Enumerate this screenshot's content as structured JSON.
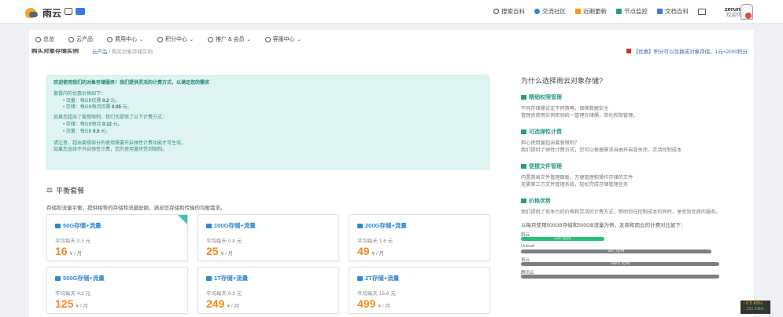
{
  "header": {
    "logo_text": "雨云",
    "nav": [
      {
        "label": "搜索百科",
        "icon": "search-icon"
      },
      {
        "label": "交流社区",
        "icon": "droplet-icon"
      },
      {
        "label": "近期更新",
        "icon": "calendar-icon"
      },
      {
        "label": "节点监控",
        "icon": "send-icon"
      },
      {
        "label": "文档百科",
        "icon": "document-icon"
      }
    ],
    "username": "zeruns",
    "user_sub": "欢迎你"
  },
  "menu": [
    {
      "label": "总览",
      "icon": "dashboard-icon"
    },
    {
      "label": "云产品",
      "icon": "cloud-icon"
    },
    {
      "label": "费用中心",
      "icon": "yen-icon"
    },
    {
      "label": "积分中心",
      "icon": "points-icon"
    },
    {
      "label": "推广 & 会员",
      "icon": "users-icon"
    },
    {
      "label": "客服中心",
      "icon": "support-icon"
    }
  ],
  "breadcrumb": {
    "title": "购买对象存储实例",
    "path": [
      "云产品",
      "购买对象存储实例"
    ],
    "right_note": "【优惠】积分可以兑换成对象存储，1元=2000积分"
  },
  "notice": {
    "title": "欢迎使用我们的对象存储服务！我们提供灵活的计费方式，以满足您的需求",
    "quota_intro": "套餐内的优惠价格如下：",
    "quota": [
      {
        "pre": "流量：每GB仅需 ",
        "val": "0.2",
        "post": " 元。"
      },
      {
        "pre": "存储：每GB每月仅需 ",
        "val": "0.05",
        "post": " 元。"
      }
    ],
    "overage_intro": "如果您超出了套餐限制，我们也提供了以下计费方式：",
    "overage": [
      {
        "pre": "存储：每GB每月 ",
        "val": "0.12",
        "post": " 元。"
      },
      {
        "pre": "流量：每GB ",
        "val": "0.5",
        "post": " 元。"
      }
    ],
    "note1": "请注意，超出套餐部分的使用需要开启弹性计费功能才可生效。",
    "note2": "如果您选择不开启弹性计费，您的使用量将受到限制。"
  },
  "plans_section": {
    "title": "平衡套餐",
    "desc": "存储和流量平衡，提供相等的存储和流量配额，满足您存储和传输的均衡需求。",
    "avg_prefix": "平均每天 ",
    "price_unit": "¥ / 月",
    "plans": [
      {
        "name": "50G存储+流量",
        "avg": "0.5 元",
        "price": "16",
        "selected": true
      },
      {
        "name": "100G存储+流量",
        "avg": "0.8 元",
        "price": "25",
        "selected": false
      },
      {
        "name": "200G存储+流量",
        "avg": "1.6 元",
        "price": "49",
        "selected": false
      },
      {
        "name": "500G存储+流量",
        "avg": "4.2 元",
        "price": "125",
        "selected": false
      },
      {
        "name": "1T存储+流量",
        "avg": "8.3 元",
        "price": "249",
        "selected": false
      },
      {
        "name": "2T存储+流量",
        "avg": "16.6 元",
        "price": "499",
        "selected": false
      }
    ]
  },
  "sidebar": {
    "heading": "为什么选择雨云对象存储?",
    "blocks": [
      {
        "title": "精细权限管理",
        "lines": [
          "不同存储桶设定不同策略，保障数据安全",
          "管理员使用实例密钥统一管理存储桶，简化权限管理。"
        ]
      },
      {
        "title": "可选弹性计费",
        "lines": [
          "担心使用量超出套餐限制？",
          "我们提供了弹性计费方式，您可以根据需求自由开启或关闭，灵活控制成本"
        ]
      },
      {
        "title": "便捷文件管理",
        "lines": [
          "内置简易文件管理面板，方便管理和操作存储的文件",
          "无需第三方文件管理系统，轻松完成存储管理任务"
        ]
      },
      {
        "title": "价格优势",
        "lines": [
          "我们提供了竞争力的价格和灵活的计费方式，帮助你在控制成本的同时，享受到优质的服务。"
        ]
      }
    ],
    "compare_intro": "以每月使用500GB存储和500GB流量为例，友商和雨云的计费对比如下：",
    "compare": [
      {
        "name": "雨云",
        "value": "125 元/月",
        "ratio": 0.42,
        "color": "#27c07a"
      },
      {
        "name": "Ucloud",
        "value": "287 元/月",
        "ratio": 0.96,
        "color": "#7c7f86"
      },
      {
        "name": "青云",
        "value": "299.5 元/月",
        "ratio": 1.0,
        "color": "#7c7f86"
      },
      {
        "name": "腾讯云",
        "value": "",
        "ratio": 1.0,
        "color": "#7c7f86"
      }
    ]
  },
  "speed": {
    "up": "0.5 KB/s",
    "down": "151 KB/s"
  }
}
